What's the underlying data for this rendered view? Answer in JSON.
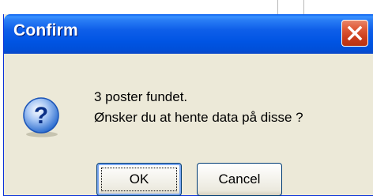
{
  "dialog": {
    "title": "Confirm",
    "message_lines": [
      "3 poster fundet.",
      "Ønsker du at hente data på disse ?"
    ],
    "icon": "question-icon",
    "buttons": {
      "ok_label": "OK",
      "cancel_label": "Cancel"
    },
    "close_icon": "close-icon"
  },
  "colors": {
    "titlebar": "#0054e3",
    "dialog_bg": "#ece9d8",
    "close_button": "#e05d3a",
    "title_text": "#ffffff"
  }
}
